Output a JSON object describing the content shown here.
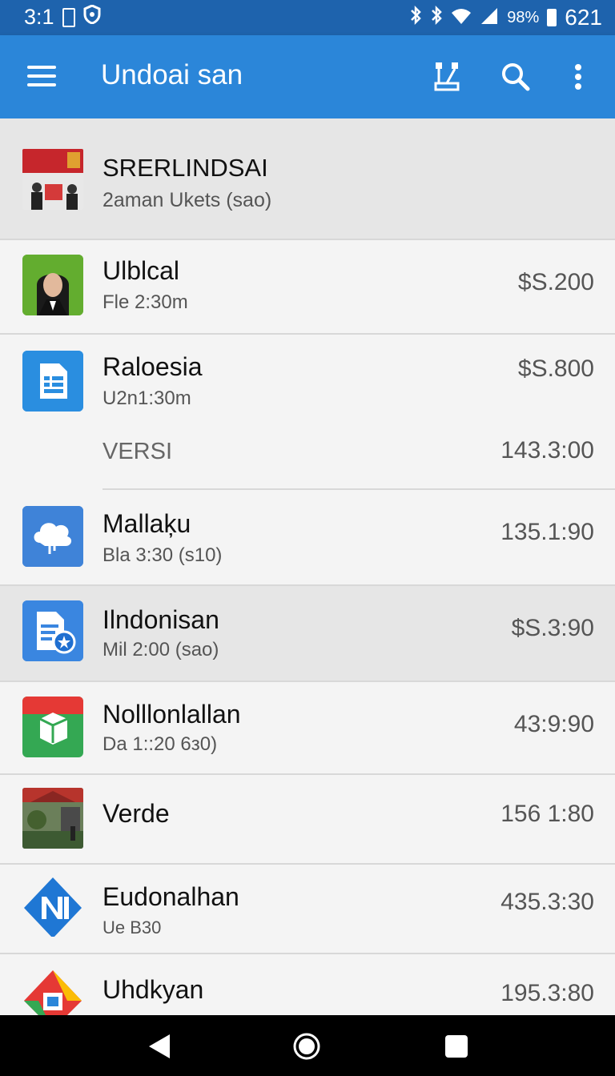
{
  "status": {
    "time_left": "3:1",
    "battery": "98%",
    "time_right": "621"
  },
  "appbar": {
    "title": "Undoai san"
  },
  "header_item": {
    "title": "SRERLINDSAI",
    "subtitle": "2aman Ukets (sao)"
  },
  "items": [
    {
      "name": "Ulblcal",
      "sub": "Fle 2:30m",
      "value": "$S.200",
      "icon": "profile-photo"
    },
    {
      "name": "Raloesia",
      "sub": "U2n1:30m",
      "value": "$S.800",
      "icon": "document-icon"
    },
    {
      "name": "",
      "sub": "VERSI",
      "value": "143.3:00",
      "icon": ""
    },
    {
      "name": "Mallaķu",
      "sub": "Bla 3:30 (s10)",
      "value": "135.1:90",
      "icon": "cloud-icon"
    },
    {
      "name": "Ilndonisan",
      "sub": "Mil 2:00 (sao)",
      "value": "$S.3:90",
      "icon": "doc-badge-icon"
    },
    {
      "name": "Nolllonlallan",
      "sub": "Da 1::20 6з0)",
      "value": "43:9:90",
      "icon": "box-icon"
    },
    {
      "name": "Verde",
      "sub": "",
      "value": "156 1:80",
      "icon": "landscape-photo"
    },
    {
      "name": "Eudonalhan",
      "sub": "Ue B30",
      "value": "435.3:30",
      "icon": "n-logo-icon"
    },
    {
      "name": "Uhdkyan",
      "sub": "",
      "value": "195.3:80",
      "icon": "colorful-logo-icon"
    }
  ]
}
